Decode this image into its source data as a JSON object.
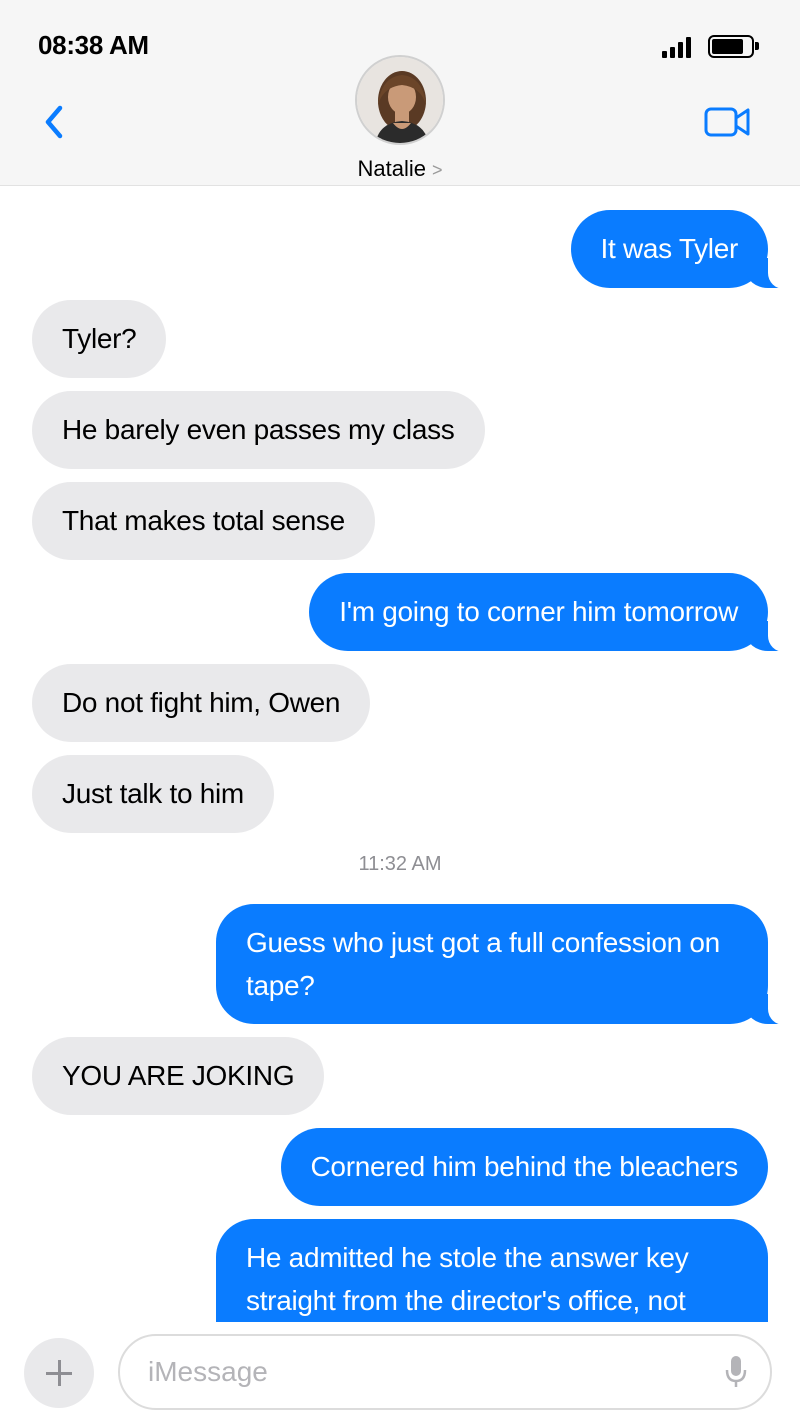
{
  "status_bar": {
    "time": "08:38 AM"
  },
  "header": {
    "contact_name": "Natalie",
    "chevron": ">"
  },
  "messages": [
    {
      "dir": "out",
      "text": "It was Tyler"
    },
    {
      "dir": "in",
      "text": "Tyler?"
    },
    {
      "dir": "in",
      "text": "He barely even passes my class"
    },
    {
      "dir": "in",
      "text": "That makes total sense"
    },
    {
      "dir": "out",
      "text": "I'm going to corner him tomorrow"
    },
    {
      "dir": "in",
      "text": "Do not fight him, Owen"
    },
    {
      "dir": "in",
      "text": "Just talk to him"
    },
    {
      "dir": "out",
      "text": "Guess who just got a full confession on tape?"
    },
    {
      "dir": "in",
      "text": "YOU ARE JOKING"
    },
    {
      "dir": "out",
      "text": "Cornered him behind the bleachers"
    },
    {
      "dir": "out",
      "text": "He admitted he stole the answer key straight from the director's office, not"
    }
  ],
  "timestamp": "11:32 AM",
  "input": {
    "placeholder": "iMessage"
  },
  "colors": {
    "outgoing": "#0a7cff",
    "incoming": "#e9e9eb",
    "accent": "#0a7cff"
  },
  "icons": [
    "back-chevron-icon",
    "video-camera-icon",
    "plus-icon",
    "microphone-icon",
    "signal-icon",
    "battery-icon"
  ]
}
